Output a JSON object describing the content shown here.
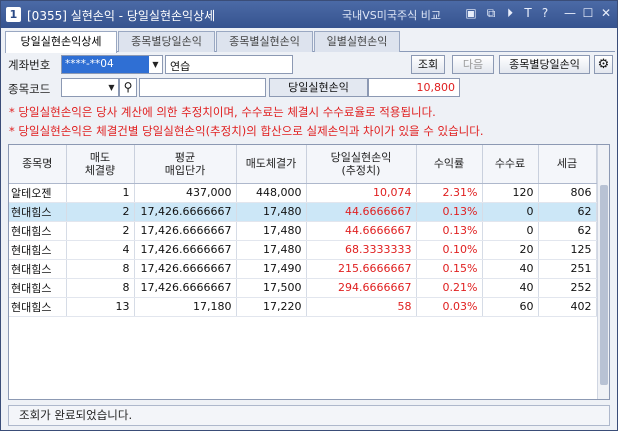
{
  "window": {
    "number": "1",
    "title": "[0355] 실현손익 - 당일실현손익상세",
    "compare_label": "국내VS미국주식 비교"
  },
  "tabs": [
    {
      "label": "당일실현손익상세"
    },
    {
      "label": "종목별당일손익"
    },
    {
      "label": "종목별실현손익"
    },
    {
      "label": "일별실현손익"
    }
  ],
  "form": {
    "account_label": "계좌번호",
    "account_value": "****-**04",
    "account_name": "연습",
    "stock_label": "종목코드",
    "stock_value": "",
    "stock_name": "",
    "realized_label": "당일실현손익",
    "realized_value": "10,800"
  },
  "buttons": {
    "query": "조회",
    "next": "다음",
    "per_stock": "종목별당일손익"
  },
  "notes": [
    "* 당일실현손익은 당사 계산에 의한 추정치이며, 수수료는 체결시 수수료율로 적용됩니다.",
    "* 당일실현손익은 체결건별 당일실현손익(추정치)의 합산으로 실제손익과 차이가 있을 수 있습니다."
  ],
  "table": {
    "headers": [
      "종목명",
      "매도\n체결량",
      "평균\n매입단가",
      "매도체결가",
      "당일실현손익\n(추정치)",
      "수익률",
      "수수료",
      "세금"
    ],
    "rows": [
      [
        "알테오젠",
        "1",
        "437,000",
        "448,000",
        "10,074",
        "2.31%",
        "120",
        "806"
      ],
      [
        "현대힘스",
        "2",
        "17,426.6666667",
        "17,480",
        "44.6666667",
        "0.13%",
        "0",
        "62"
      ],
      [
        "현대힘스",
        "2",
        "17,426.6666667",
        "17,480",
        "44.6666667",
        "0.13%",
        "0",
        "62"
      ],
      [
        "현대힘스",
        "4",
        "17,426.6666667",
        "17,480",
        "68.3333333",
        "0.10%",
        "20",
        "125"
      ],
      [
        "현대힘스",
        "8",
        "17,426.6666667",
        "17,490",
        "215.6666667",
        "0.15%",
        "40",
        "251"
      ],
      [
        "현대힘스",
        "8",
        "17,426.6666667",
        "17,500",
        "294.6666667",
        "0.21%",
        "40",
        "252"
      ],
      [
        "현대힘스",
        "13",
        "17,180",
        "17,220",
        "58",
        "0.03%",
        "60",
        "402"
      ]
    ],
    "selected_row": 1
  },
  "status": "조회가 완료되었습니다.",
  "colors": {
    "title_bar": "#3d5a96",
    "accent_red": "#e02020",
    "selected_row": "#cce7f7"
  }
}
